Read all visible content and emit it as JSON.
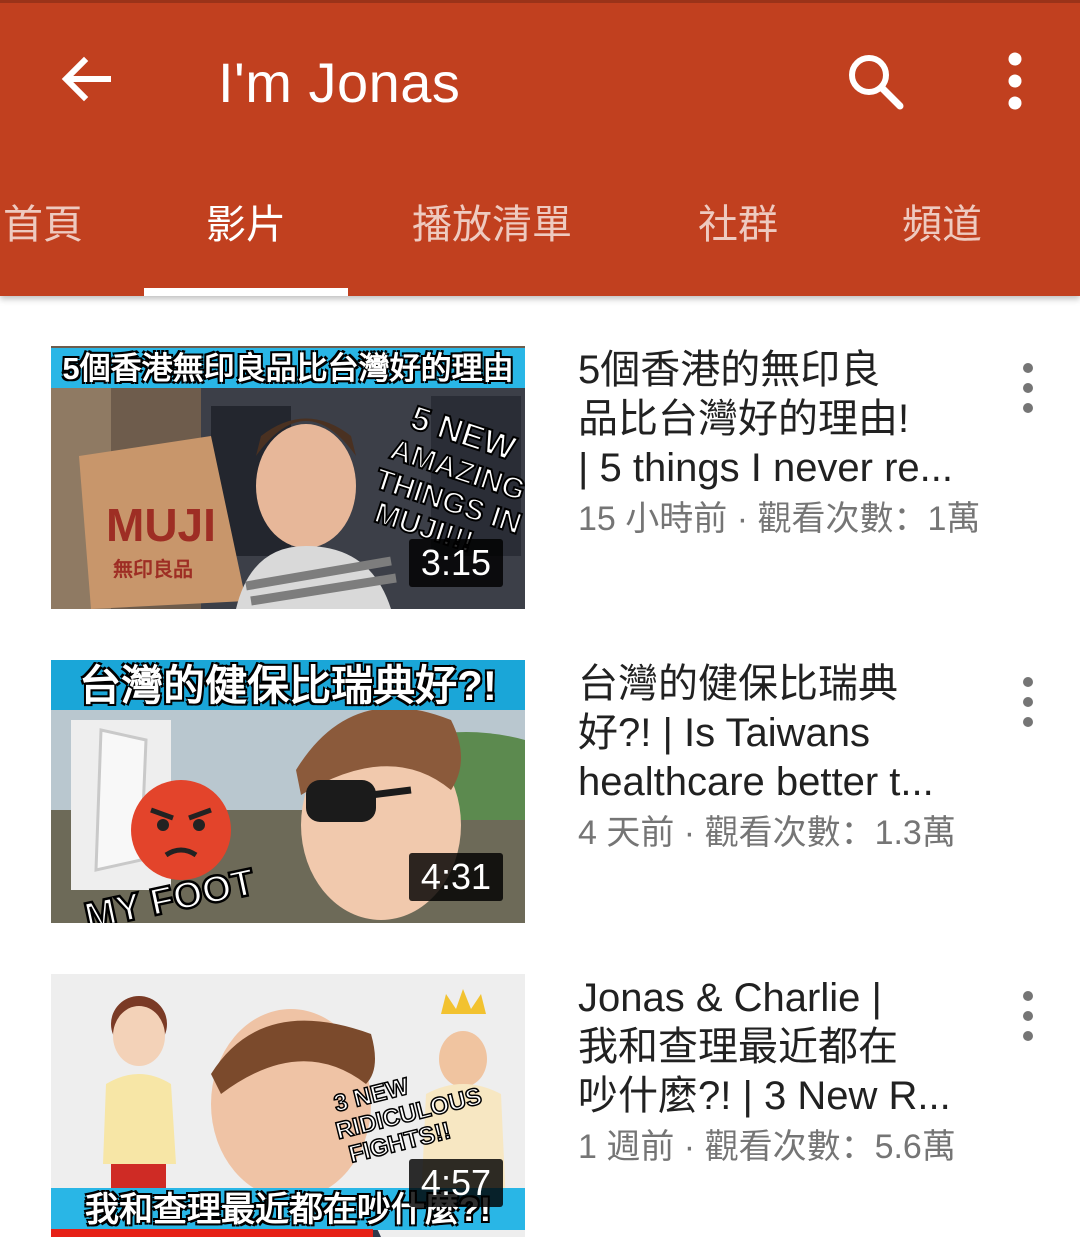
{
  "app_bar": {
    "title": "I'm Jonas",
    "back_icon": "arrow-left-icon",
    "search_icon": "search-icon",
    "more_icon": "more-vert-icon",
    "background_color": "#c1401f"
  },
  "tabs": [
    {
      "label": "首頁",
      "active": false
    },
    {
      "label": "影片",
      "active": true
    },
    {
      "label": "播放清單",
      "active": false
    },
    {
      "label": "社群",
      "active": false
    },
    {
      "label": "頻道",
      "active": false
    }
  ],
  "videos": [
    {
      "thumbnail_text": "5個香港無印良品比台灣好的理由",
      "duration": "3:15",
      "title_lines": [
        "5個香港的無印良",
        "品比台灣好的理由!",
        "| 5 things I never re..."
      ],
      "subtitle": "15 小時前 · 觀看次數：1萬"
    },
    {
      "thumbnail_text": "台灣的健保比瑞典好?!",
      "duration": "4:31",
      "title_lines": [
        "台灣的健保比瑞典",
        "好?! | Is Taiwans",
        "healthcare better t..."
      ],
      "subtitle": "4 天前 · 觀看次數：1.3萬"
    },
    {
      "thumbnail_text": "我和查理最近都在吵什麼?!",
      "duration": "4:57",
      "watched_fraction": 0.68,
      "title_lines": [
        "Jonas & Charlie |",
        "我和查理最近都在",
        "吵什麼?! | 3 New R..."
      ],
      "subtitle": "1 週前 · 觀看次數：5.6萬"
    }
  ]
}
